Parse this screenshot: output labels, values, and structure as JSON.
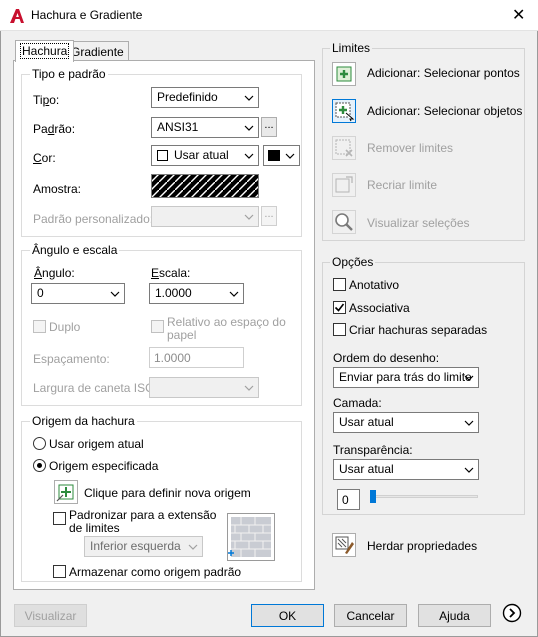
{
  "window": {
    "title": "Hachura e Gradiente",
    "close": "✕"
  },
  "tabs": [
    "Hachura",
    "Gradiente"
  ],
  "tipo_padrao": {
    "group": "Tipo e padrão",
    "tipo_label": "Tipo:",
    "tipo_value": "Predefinido",
    "padrao_label": "Padrão:",
    "padrao_value": "ANSI31",
    "browse": "...",
    "cor_label": "Cor:",
    "cor_value": "Usar atual",
    "amostra_label": "Amostra:",
    "personalizado_label": "Padrão personalizado:",
    "personalizado_value": "",
    "browse2": "..."
  },
  "angulo_escala": {
    "group": "Ângulo e escala",
    "angulo_label": "Ângulo:",
    "angulo_value": "0",
    "escala_label": "Escala:",
    "escala_value": "1.0000",
    "duplo": "Duplo",
    "relativo": "Relativo ao espaço do papel",
    "espacamento_label": "Espaçamento:",
    "espacamento_value": "1.0000",
    "caneta_label": "Largura de caneta ISO:"
  },
  "origem": {
    "group": "Origem da hachura",
    "usar_atual": "Usar origem atual",
    "especificada": "Origem especificada",
    "clique": "Clique para definir nova origem",
    "padronizar": "Padronizar para a extensão de limites",
    "padronizar_value": "Inferior esquerda",
    "armazenar": "Armazenar como origem padrão"
  },
  "limites": {
    "group": "Limites",
    "selecionar_pontos": "Adicionar: Selecionar pontos",
    "selecionar_objetos": "Adicionar: Selecionar objetos",
    "remover": "Remover limites",
    "recriar": "Recriar limite",
    "visualizar_selecoes": "Visualizar seleções"
  },
  "opcoes": {
    "group": "Opções",
    "anotativo": "Anotativo",
    "associativa": "Associativa",
    "separadas": "Criar hachuras separadas",
    "ordem_label": "Ordem do desenho:",
    "ordem_value": "Enviar para trás do limite",
    "camada_label": "Camada:",
    "camada_value": "Usar atual",
    "transp_label": "Transparência:",
    "transp_value": "Usar atual",
    "transp_number": "0"
  },
  "herdar": "Herdar propriedades",
  "footer": {
    "visualizar": "Visualizar",
    "ok": "OK",
    "cancelar": "Cancelar",
    "ajuda": "Ajuda"
  },
  "colors": {
    "accent": "#0078d7",
    "logo": "#c8102e",
    "icon_green": "#2e8b3e"
  }
}
